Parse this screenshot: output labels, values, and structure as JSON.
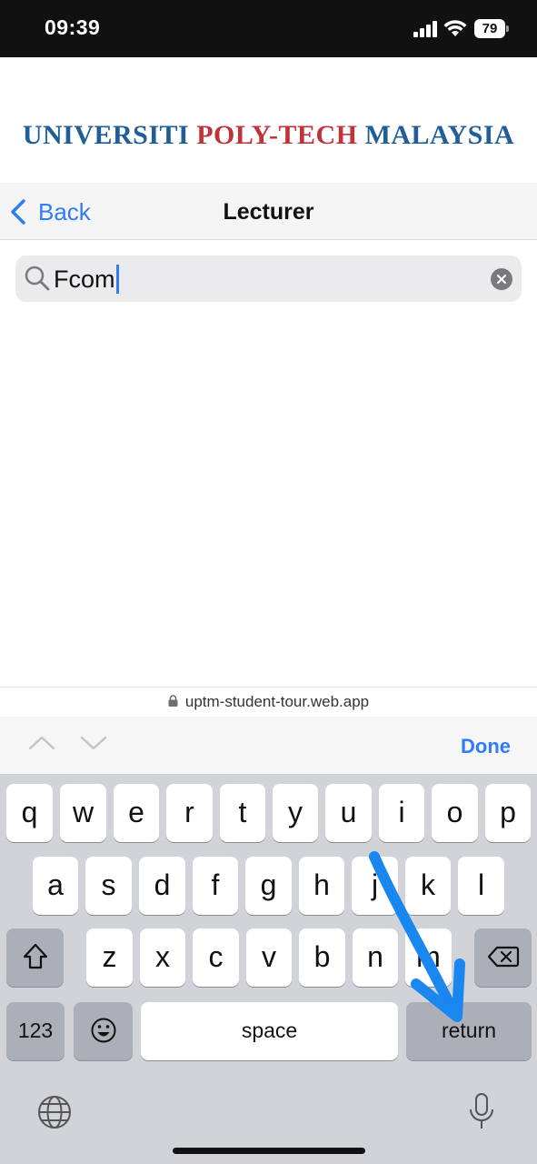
{
  "status_bar": {
    "time": "09:39",
    "battery": "79"
  },
  "header": {
    "logo": {
      "part1": "UNIVERSITI",
      "part2": "POLY-TECH",
      "part3": "MALAYSIA"
    }
  },
  "nav": {
    "back_label": "Back",
    "title": "Lecturer"
  },
  "search": {
    "value": "Fcom"
  },
  "browser": {
    "url": "uptm-student-tour.web.app"
  },
  "accessory": {
    "done_label": "Done"
  },
  "keyboard": {
    "row1": [
      "q",
      "w",
      "e",
      "r",
      "t",
      "y",
      "u",
      "i",
      "o",
      "p"
    ],
    "row2": [
      "a",
      "s",
      "d",
      "f",
      "g",
      "h",
      "j",
      "k",
      "l"
    ],
    "row3": [
      "z",
      "x",
      "c",
      "v",
      "b",
      "n",
      "m"
    ],
    "numbers_label": "123",
    "space_label": "space",
    "return_label": "return"
  },
  "colors": {
    "accent": "#2f7cf6",
    "logo_blue": "#1f5e96",
    "logo_red": "#c0333b",
    "annotation_arrow": "#1a86f0"
  },
  "icons": [
    "signal-icon",
    "wifi-icon",
    "battery-icon",
    "chevron-left-icon",
    "search-icon",
    "clear-icon",
    "lock-icon",
    "chevron-up-icon",
    "chevron-down-icon",
    "shift-icon",
    "delete-icon",
    "emoji-icon",
    "globe-icon",
    "microphone-icon",
    "arrow-annotation"
  ]
}
